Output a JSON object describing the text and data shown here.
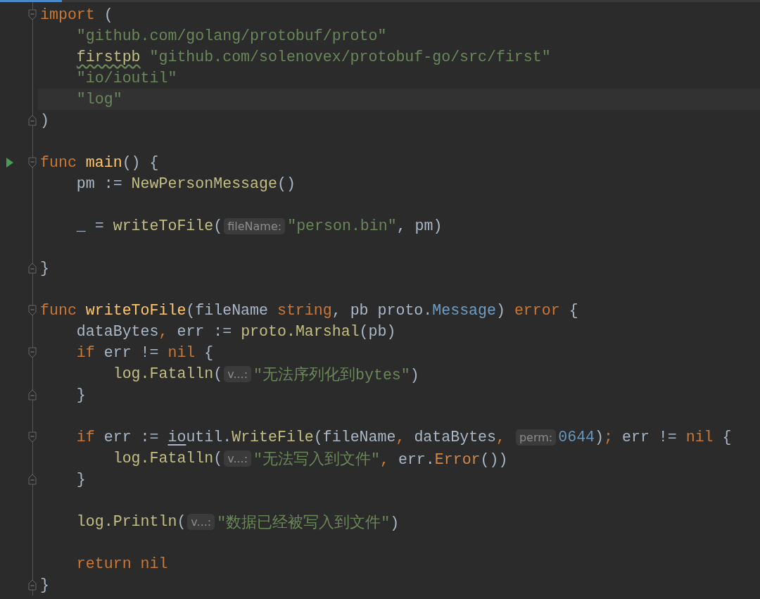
{
  "editor": {
    "lines": [
      {
        "fold_start": true,
        "segments": [
          {
            "kind": "code",
            "tokens": [
              {
                "text": "import",
                "kind": "kw"
              },
              {
                "text": " (",
                "kind": "plain"
              }
            ]
          }
        ]
      },
      {
        "segments": [
          {
            "kind": "code",
            "tokens": [
              {
                "text": "    \"github.com/golang/protobuf/proto\"",
                "kind": "str"
              }
            ]
          }
        ]
      },
      {
        "segments": [
          {
            "kind": "code",
            "tokens": [
              {
                "text": "    firstpb",
                "kind": "warn"
              },
              {
                "text": " \"github.com/solenovex/protobuf-go/src/first\"",
                "kind": "str"
              }
            ]
          }
        ]
      },
      {
        "segments": [
          {
            "kind": "code",
            "tokens": [
              {
                "text": "    \"io/ioutil\"",
                "kind": "str"
              }
            ]
          }
        ]
      },
      {
        "current": true,
        "segments": [
          {
            "kind": "code",
            "tokens": [
              {
                "text": "    \"log\"",
                "kind": "str"
              }
            ]
          }
        ]
      },
      {
        "fold_end": true,
        "segments": [
          {
            "kind": "code",
            "tokens": [
              {
                "text": ")",
                "kind": "plain"
              }
            ]
          }
        ]
      },
      {
        "blank_before": true,
        "fold_start": true,
        "run": true,
        "segments": [
          {
            "kind": "code",
            "tokens": [
              {
                "text": "func",
                "kind": "kw"
              },
              {
                "text": " main",
                "kind": "decl"
              },
              {
                "text": "() {",
                "kind": "plain"
              }
            ]
          }
        ]
      },
      {
        "segments": [
          {
            "kind": "code",
            "tokens": [
              {
                "text": "    pm := ",
                "kind": "plain"
              },
              {
                "text": "NewPersonMessage",
                "kind": "call"
              },
              {
                "text": "()",
                "kind": "plain"
              }
            ]
          }
        ]
      },
      {
        "blank_before": true,
        "segments": [
          {
            "kind": "code",
            "tokens": [
              {
                "text": "    _ = ",
                "kind": "plain"
              },
              {
                "text": "writeToFile",
                "kind": "call"
              },
              {
                "text": "(",
                "kind": "plain"
              }
            ]
          },
          {
            "kind": "hint",
            "text": "fileName:"
          },
          {
            "kind": "code",
            "tokens": [
              {
                "text": "\"person.bin\"",
                "kind": "str"
              },
              {
                "text": ", pm)",
                "kind": "plain"
              }
            ]
          }
        ]
      },
      {
        "blank_before": true,
        "fold_end": true,
        "segments": [
          {
            "kind": "code",
            "tokens": [
              {
                "text": "}",
                "kind": "plain"
              }
            ]
          }
        ]
      },
      {
        "blank_before": true,
        "fold_start": true,
        "segments": [
          {
            "kind": "code",
            "tokens": [
              {
                "text": "func",
                "kind": "kw"
              },
              {
                "text": " writeToFile",
                "kind": "decl"
              },
              {
                "text": "(fileName ",
                "kind": "plain"
              },
              {
                "text": "string",
                "kind": "kw"
              },
              {
                "text": ", pb proto.",
                "kind": "plain"
              },
              {
                "text": "Message",
                "kind": "type"
              },
              {
                "text": ") ",
                "kind": "plain"
              },
              {
                "text": "error",
                "kind": "kw"
              },
              {
                "text": " {",
                "kind": "plain"
              }
            ]
          }
        ]
      },
      {
        "segments": [
          {
            "kind": "code",
            "tokens": [
              {
                "text": "    dataBytes",
                "kind": "plain"
              },
              {
                "text": ",",
                "kind": "kw"
              },
              {
                "text": " err := ",
                "kind": "plain"
              },
              {
                "text": "proto.Marshal",
                "kind": "call"
              },
              {
                "text": "(pb)",
                "kind": "plain"
              }
            ]
          }
        ]
      },
      {
        "fold_start": true,
        "segments": [
          {
            "kind": "code",
            "tokens": [
              {
                "text": "    if",
                "kind": "kw"
              },
              {
                "text": " err != ",
                "kind": "plain"
              },
              {
                "text": "nil",
                "kind": "kw"
              },
              {
                "text": " {",
                "kind": "plain"
              }
            ]
          }
        ]
      },
      {
        "segments": [
          {
            "kind": "code",
            "tokens": [
              {
                "text": "        log.Fatalln",
                "kind": "call"
              },
              {
                "text": "(",
                "kind": "plain"
              }
            ]
          },
          {
            "kind": "hint",
            "text": "v...:"
          },
          {
            "kind": "code",
            "tokens": [
              {
                "text": "\"无法序列化到bytes\"",
                "kind": "str"
              },
              {
                "text": ")",
                "kind": "plain"
              }
            ]
          }
        ]
      },
      {
        "fold_end": true,
        "segments": [
          {
            "kind": "code",
            "tokens": [
              {
                "text": "    }",
                "kind": "plain"
              }
            ]
          }
        ]
      },
      {
        "blank_before": true,
        "fold_start": true,
        "segments": [
          {
            "kind": "code",
            "tokens": [
              {
                "text": "    if",
                "kind": "kw"
              },
              {
                "text": " err := ",
                "kind": "plain"
              },
              {
                "text": "io",
                "kind": "under"
              },
              {
                "text": "util.",
                "kind": "plain"
              },
              {
                "text": "WriteFile",
                "kind": "call"
              },
              {
                "text": "(fileName",
                "kind": "plain"
              },
              {
                "text": ",",
                "kind": "kw"
              },
              {
                "text": " dataBytes",
                "kind": "plain"
              },
              {
                "text": ", ",
                "kind": "kw"
              }
            ]
          },
          {
            "kind": "hint",
            "text": "perm:"
          },
          {
            "kind": "code",
            "tokens": [
              {
                "text": "0644",
                "kind": "num"
              },
              {
                "text": ")",
                "kind": "plain"
              },
              {
                "text": ";",
                "kind": "kw"
              },
              {
                "text": " err != ",
                "kind": "plain"
              },
              {
                "text": "nil",
                "kind": "kw"
              },
              {
                "text": " {",
                "kind": "plain"
              }
            ]
          }
        ]
      },
      {
        "segments": [
          {
            "kind": "code",
            "tokens": [
              {
                "text": "        log.Fatalln",
                "kind": "call"
              },
              {
                "text": "(",
                "kind": "plain"
              }
            ]
          },
          {
            "kind": "hint",
            "text": "v...:"
          },
          {
            "kind": "code",
            "tokens": [
              {
                "text": "\"无法写入到文件\"",
                "kind": "str"
              },
              {
                "text": ",",
                "kind": "kw"
              },
              {
                "text": " err.",
                "kind": "plain"
              },
              {
                "text": "Error",
                "kind": "meth"
              },
              {
                "text": "())",
                "kind": "plain"
              }
            ]
          }
        ]
      },
      {
        "fold_end": true,
        "segments": [
          {
            "kind": "code",
            "tokens": [
              {
                "text": "    }",
                "kind": "plain"
              }
            ]
          }
        ]
      },
      {
        "blank_before": true,
        "segments": [
          {
            "kind": "code",
            "tokens": [
              {
                "text": "    log.Println",
                "kind": "call"
              },
              {
                "text": "(",
                "kind": "plain"
              }
            ]
          },
          {
            "kind": "hint",
            "text": "v...:"
          },
          {
            "kind": "code",
            "tokens": [
              {
                "text": "\"数据已经被写入到文件\"",
                "kind": "str"
              },
              {
                "text": ")",
                "kind": "plain"
              }
            ]
          }
        ]
      },
      {
        "blank_before": true,
        "segments": [
          {
            "kind": "code",
            "tokens": [
              {
                "text": "    return",
                "kind": "kw"
              },
              {
                "text": " nil",
                "kind": "kw"
              }
            ]
          }
        ]
      },
      {
        "fold_end": true,
        "segments": [
          {
            "kind": "code",
            "tokens": [
              {
                "text": "}",
                "kind": "plain"
              }
            ]
          }
        ]
      }
    ]
  }
}
